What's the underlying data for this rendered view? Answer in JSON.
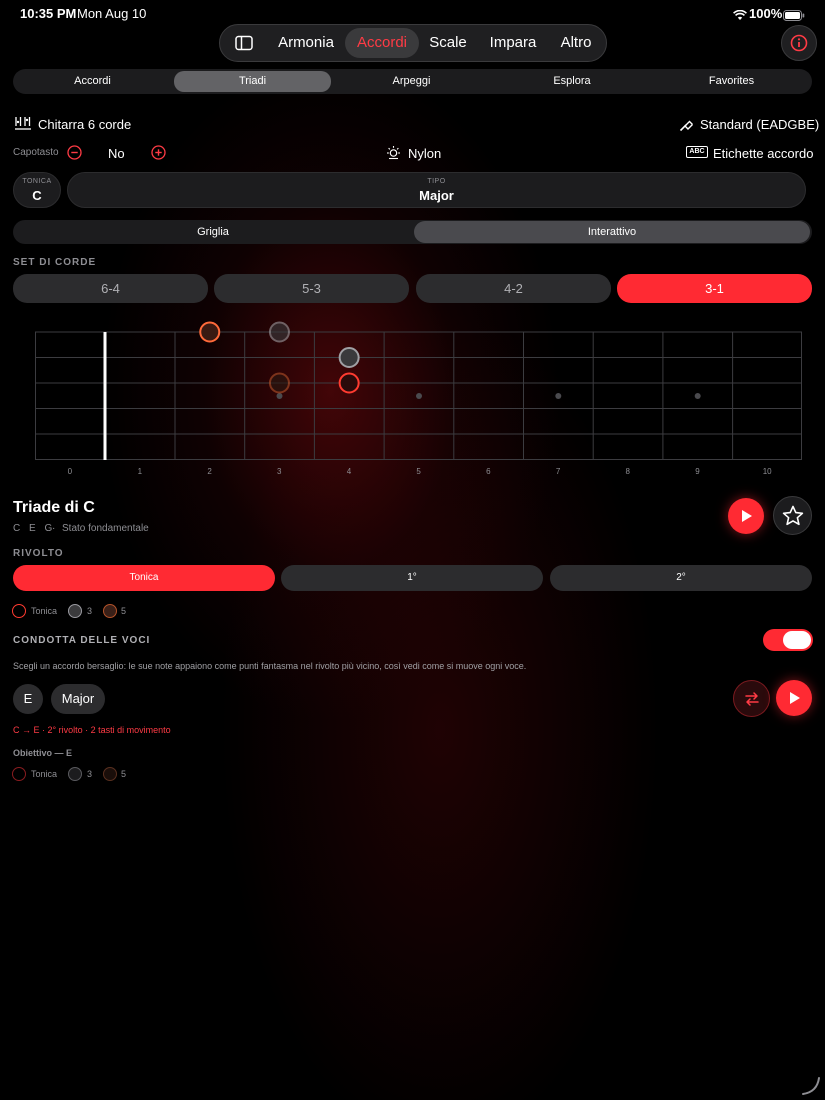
{
  "status": {
    "time": "10:35 PM",
    "date": "Mon Aug 10",
    "battery": "100%"
  },
  "topnav": {
    "items": [
      "Armonia",
      "Accordi",
      "Scale",
      "Impara",
      "Altro"
    ],
    "selected": "Accordi"
  },
  "subtabs": {
    "items": [
      "Accordi",
      "Triadi",
      "Arpeggi",
      "Esplora",
      "Favorites"
    ],
    "selected": "Triadi"
  },
  "instrument": {
    "name": "Chitarra 6 corde",
    "tuning": "Standard (EADGBE)"
  },
  "capo": {
    "label": "Capotasto",
    "value": "No"
  },
  "string_type": "Nylon",
  "chord_labels": "Etichette accordo",
  "root": {
    "label": "TONICA",
    "value": "C"
  },
  "type": {
    "label": "TIPO",
    "value": "Major"
  },
  "view": {
    "items": [
      "Griglia",
      "Interattivo"
    ],
    "selected": "Interattivo"
  },
  "string_sets": {
    "title": "SET DI CORDE",
    "items": [
      "6-4",
      "5-3",
      "4-2",
      "3-1"
    ],
    "selected": "3-1"
  },
  "fretboard": {
    "fret_numbers": [
      "0",
      "1",
      "2",
      "3",
      "4",
      "5",
      "6",
      "7",
      "8",
      "9",
      "10"
    ],
    "notes": [
      {
        "string": 1,
        "fret": 3,
        "role": "tonic"
      },
      {
        "string": 1,
        "fret": 4,
        "role": "third",
        "ghost": true
      },
      {
        "string": 2,
        "fret": 5,
        "role": "third"
      },
      {
        "string": 3,
        "fret": 4,
        "role": "fifth",
        "ghost": true
      },
      {
        "string": 3,
        "fret": 5,
        "role": "tonic"
      }
    ]
  },
  "triad": {
    "title": "Triade di C",
    "notes": "C E G",
    "state": "Stato fondamentale"
  },
  "inversion": {
    "title": "RIVOLTO",
    "items": [
      "Tonica",
      "1°",
      "2°"
    ],
    "selected": "Tonica"
  },
  "legend": [
    "Tonica",
    "3",
    "5"
  ],
  "voice_leading": {
    "title": "CONDOTTA DELLE VOCI",
    "enabled": true,
    "description": "Scegli un accordo bersaglio: le sue note appaiono come punti fantasma nel rivolto più vicino, così vedi come si muove ogni voce.",
    "target_root": "E",
    "target_type": "Major",
    "summary": "C → E · 2° rivolto · 2 tasti di movimento",
    "target_label": "Obiettivo — E"
  },
  "colors": {
    "accent": "#ff2a33",
    "tonic": "#ff3b30",
    "third": "#8e8e93",
    "fifth": "#b4532a",
    "background": "#000000"
  },
  "icons": [
    "sidebar-icon",
    "info-icon",
    "guitar-strings-icon",
    "tuning-fork-icon",
    "minus-icon",
    "plus-icon",
    "sun-icon",
    "abc-icon",
    "play-icon",
    "star-icon",
    "swap-icon"
  ]
}
